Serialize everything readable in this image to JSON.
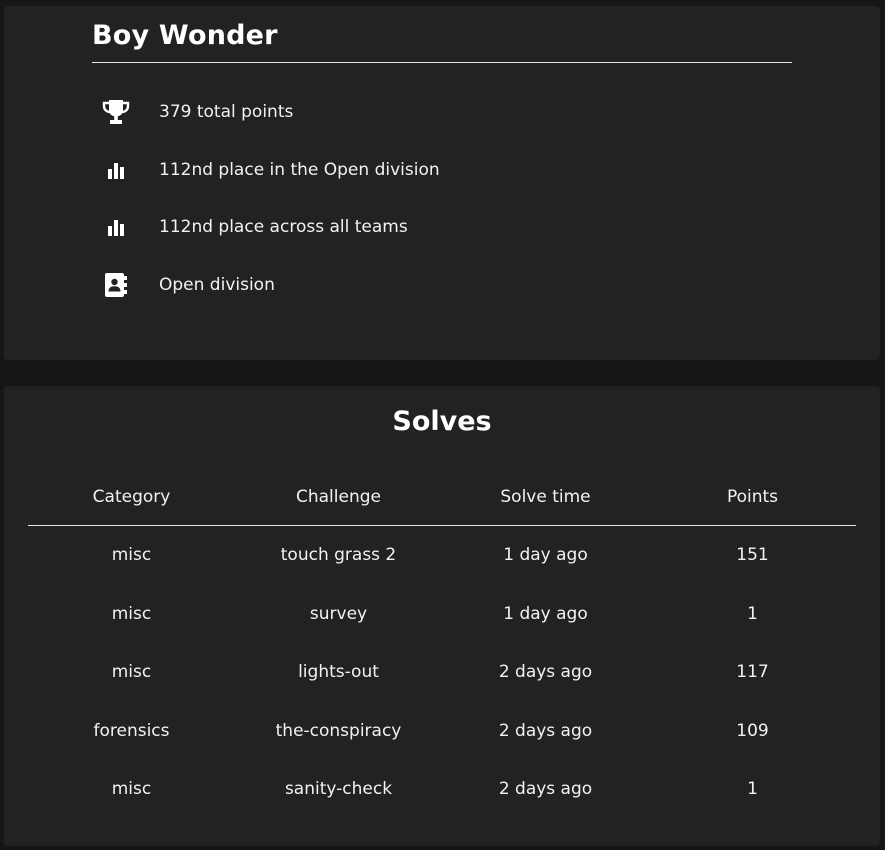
{
  "team": {
    "name": "Boy Wonder",
    "stats": [
      {
        "icon": "trophy-icon",
        "text": "379 total points"
      },
      {
        "icon": "bar-chart-icon",
        "text": "112nd place in the Open division"
      },
      {
        "icon": "bar-chart-icon",
        "text": "112nd place across all teams"
      },
      {
        "icon": "contact-book-icon",
        "text": "Open division"
      }
    ]
  },
  "solves": {
    "title": "Solves",
    "columns": [
      "Category",
      "Challenge",
      "Solve time",
      "Points"
    ],
    "rows": [
      {
        "category": "misc",
        "challenge": "touch grass 2",
        "time": "1 day ago",
        "points": "151"
      },
      {
        "category": "misc",
        "challenge": "survey",
        "time": "1 day ago",
        "points": "1"
      },
      {
        "category": "misc",
        "challenge": "lights-out",
        "time": "2 days ago",
        "points": "117"
      },
      {
        "category": "forensics",
        "challenge": "the-conspiracy",
        "time": "2 days ago",
        "points": "109"
      },
      {
        "category": "misc",
        "challenge": "sanity-check",
        "time": "2 days ago",
        "points": "1"
      }
    ]
  }
}
